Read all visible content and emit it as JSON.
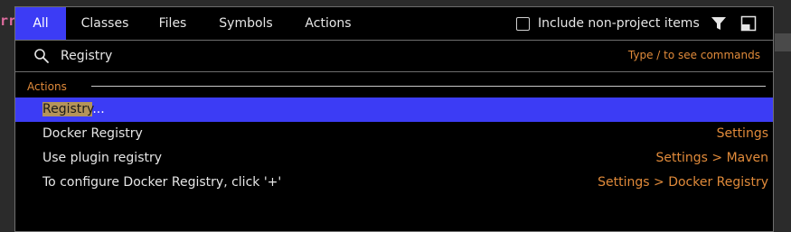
{
  "background": {
    "code_fragment": "rr"
  },
  "tabs": [
    {
      "label": "All",
      "active": true
    },
    {
      "label": "Classes",
      "active": false
    },
    {
      "label": "Files",
      "active": false
    },
    {
      "label": "Symbols",
      "active": false
    },
    {
      "label": "Actions",
      "active": false
    }
  ],
  "include_non_project": {
    "label": "Include non-project items",
    "checked": false
  },
  "toolbar_icons": [
    "filter-icon",
    "layout-icon"
  ],
  "search": {
    "value": "Registry",
    "hint": "Type / to see commands"
  },
  "section": {
    "title": "Actions"
  },
  "results": [
    {
      "match": "Registry",
      "rest": "...",
      "location": "",
      "selected": true
    },
    {
      "match": "",
      "rest": "Docker Registry",
      "location": "Settings",
      "selected": false
    },
    {
      "match": "",
      "rest": "Use plugin registry",
      "location": "Settings > Maven",
      "selected": false
    },
    {
      "match": "",
      "rest": "To configure Docker Registry, click '+'",
      "location": "Settings > Docker Registry",
      "selected": false
    }
  ],
  "colors": {
    "accent": "#3c3cf5",
    "hint": "#e08a3a",
    "match_highlight": "#b5945a",
    "popup_bg": "#000000"
  }
}
